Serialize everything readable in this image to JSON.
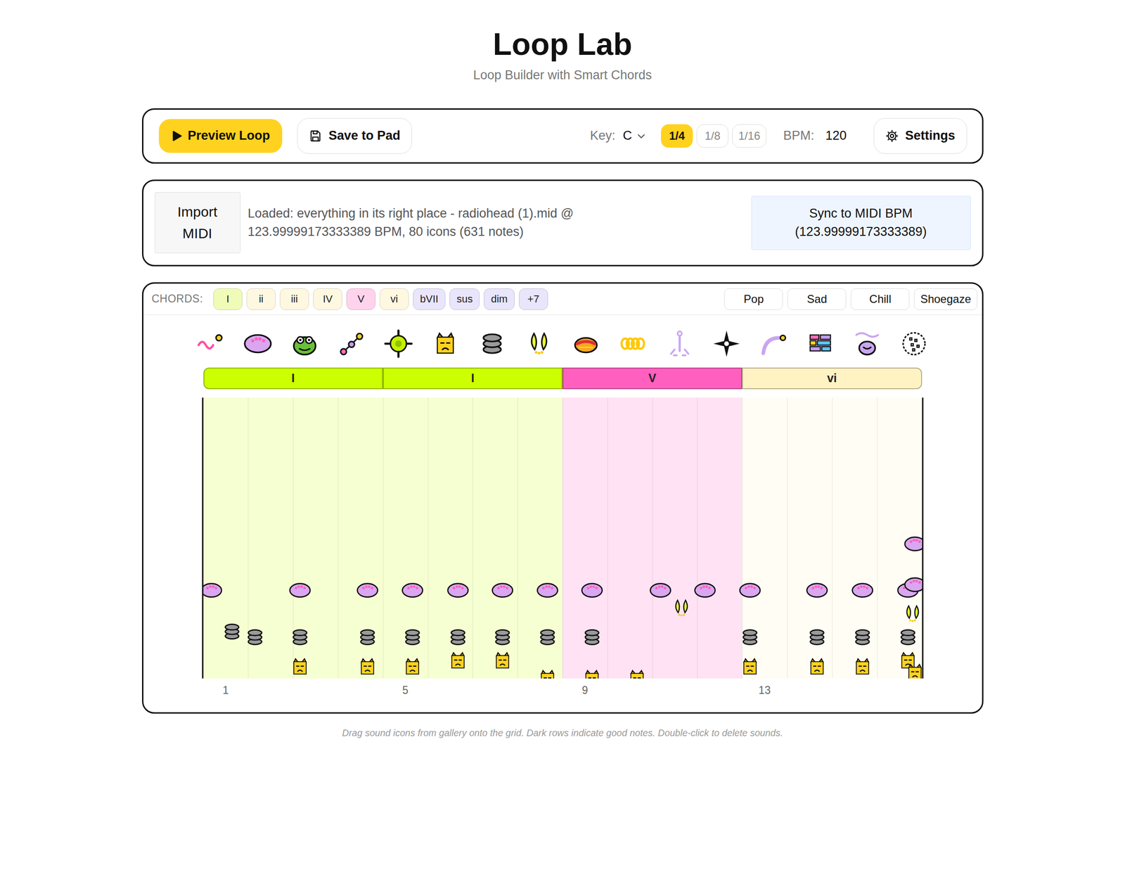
{
  "app": {
    "title": "Loop Lab",
    "subtitle": "Loop Builder with Smart Chords"
  },
  "toolbar": {
    "preview_label": "Preview Loop",
    "save_label": "Save to Pad",
    "key": {
      "label": "Key:",
      "value": "C"
    },
    "grid_options": [
      {
        "label": "1/4",
        "selected": true
      },
      {
        "label": "1/8",
        "selected": false
      },
      {
        "label": "1/16",
        "selected": false
      }
    ],
    "bpm": {
      "label": "BPM:",
      "value": "120"
    },
    "settings_label": "Settings"
  },
  "midi": {
    "import_label": "Import MIDI",
    "status": "Loaded: everything in its right place - radiohead (1).mid @ 123.99999173333389 BPM, 80 icons (631 notes)",
    "sync_label": "Sync to MIDI BPM (123.99999173333389)"
  },
  "chords": {
    "label": "CHORDS:",
    "items": [
      {
        "label": "I",
        "color": "#f0fbb8"
      },
      {
        "label": "ii",
        "color": "#fff8e1"
      },
      {
        "label": "iii",
        "color": "#fff8e1"
      },
      {
        "label": "IV",
        "color": "#fff8e1"
      },
      {
        "label": "V",
        "color": "#ffd3ec"
      },
      {
        "label": "vi",
        "color": "#fff8e1"
      },
      {
        "label": "bVII",
        "color": "#e9e5fb"
      },
      {
        "label": "sus",
        "color": "#e9e5fb"
      },
      {
        "label": "dim",
        "color": "#e9e5fb"
      },
      {
        "label": "+7",
        "color": "#e9e5fb"
      }
    ],
    "presets": [
      "Pop",
      "Sad",
      "Chill",
      "Shoegaze"
    ]
  },
  "gallery": [
    {
      "kind": "wave"
    },
    {
      "kind": "blob"
    },
    {
      "kind": "frog"
    },
    {
      "kind": "beads"
    },
    {
      "kind": "target"
    },
    {
      "kind": "cat"
    },
    {
      "kind": "stack"
    },
    {
      "kind": "leaves"
    },
    {
      "kind": "hotdog"
    },
    {
      "kind": "coil"
    },
    {
      "kind": "anchor"
    },
    {
      "kind": "star"
    },
    {
      "kind": "arc"
    },
    {
      "kind": "bricks"
    },
    {
      "kind": "bowl"
    },
    {
      "kind": "disco"
    }
  ],
  "progression": [
    {
      "label": "I",
      "color": "#ccff00"
    },
    {
      "label": "I",
      "color": "#ccff00"
    },
    {
      "label": "V",
      "color": "#ff5fbf"
    },
    {
      "label": "vi",
      "color": "#fff3c4"
    }
  ],
  "grid": {
    "beats": 16,
    "rows": 48,
    "bar_numbers": [
      "1",
      "5",
      "9",
      "13"
    ],
    "notes": [
      {
        "kind": "blob",
        "beat": 0.18,
        "row": 15
      },
      {
        "kind": "blob",
        "beat": 2.16,
        "row": 15
      },
      {
        "kind": "blob",
        "beat": 3.66,
        "row": 15
      },
      {
        "kind": "blob",
        "beat": 4.66,
        "row": 15
      },
      {
        "kind": "blob",
        "beat": 5.67,
        "row": 15
      },
      {
        "kind": "blob",
        "beat": 6.66,
        "row": 15
      },
      {
        "kind": "blob",
        "beat": 7.67,
        "row": 15
      },
      {
        "kind": "blob",
        "beat": 8.66,
        "row": 15
      },
      {
        "kind": "blob",
        "beat": 10.18,
        "row": 15
      },
      {
        "kind": "blob",
        "beat": 11.17,
        "row": 15
      },
      {
        "kind": "blob",
        "beat": 12.17,
        "row": 15
      },
      {
        "kind": "blob",
        "beat": 13.67,
        "row": 15
      },
      {
        "kind": "blob",
        "beat": 14.68,
        "row": 15
      },
      {
        "kind": "blob",
        "beat": 15.69,
        "row": 15
      },
      {
        "kind": "blob",
        "beat": 15.85,
        "row": 23
      },
      {
        "kind": "blob",
        "beat": 15.85,
        "row": 16
      },
      {
        "kind": "stack",
        "beat": 0.64,
        "row": 8
      },
      {
        "kind": "stack",
        "beat": 1.15,
        "row": 7
      },
      {
        "kind": "stack",
        "beat": 2.16,
        "row": 7
      },
      {
        "kind": "stack",
        "beat": 3.66,
        "row": 7
      },
      {
        "kind": "stack",
        "beat": 4.66,
        "row": 7
      },
      {
        "kind": "stack",
        "beat": 5.67,
        "row": 7
      },
      {
        "kind": "stack",
        "beat": 6.66,
        "row": 7
      },
      {
        "kind": "stack",
        "beat": 7.67,
        "row": 7
      },
      {
        "kind": "stack",
        "beat": 8.66,
        "row": 7
      },
      {
        "kind": "stack",
        "beat": 12.17,
        "row": 7
      },
      {
        "kind": "stack",
        "beat": 13.67,
        "row": 7
      },
      {
        "kind": "stack",
        "beat": 14.68,
        "row": 7
      },
      {
        "kind": "stack",
        "beat": 15.69,
        "row": 7
      },
      {
        "kind": "cat",
        "beat": 2.16,
        "row": 2
      },
      {
        "kind": "cat",
        "beat": 3.66,
        "row": 2
      },
      {
        "kind": "cat",
        "beat": 4.66,
        "row": 2
      },
      {
        "kind": "cat",
        "beat": 12.17,
        "row": 2
      },
      {
        "kind": "cat",
        "beat": 13.67,
        "row": 2
      },
      {
        "kind": "cat",
        "beat": 14.68,
        "row": 2
      },
      {
        "kind": "cat",
        "beat": 5.67,
        "row": 3
      },
      {
        "kind": "cat",
        "beat": 6.66,
        "row": 3
      },
      {
        "kind": "cat",
        "beat": 15.69,
        "row": 3
      },
      {
        "kind": "cat",
        "beat": 7.67,
        "row": 0
      },
      {
        "kind": "cat",
        "beat": 8.66,
        "row": 0
      },
      {
        "kind": "cat",
        "beat": 9.66,
        "row": 0
      },
      {
        "kind": "cat",
        "beat": 15.85,
        "row": 1
      },
      {
        "kind": "leaves",
        "beat": 10.65,
        "row": 12
      },
      {
        "kind": "leaves",
        "beat": 15.8,
        "row": 11
      }
    ]
  },
  "footer": "Drag sound icons from gallery onto the grid. Dark rows indicate good notes. Double-click to delete sounds."
}
